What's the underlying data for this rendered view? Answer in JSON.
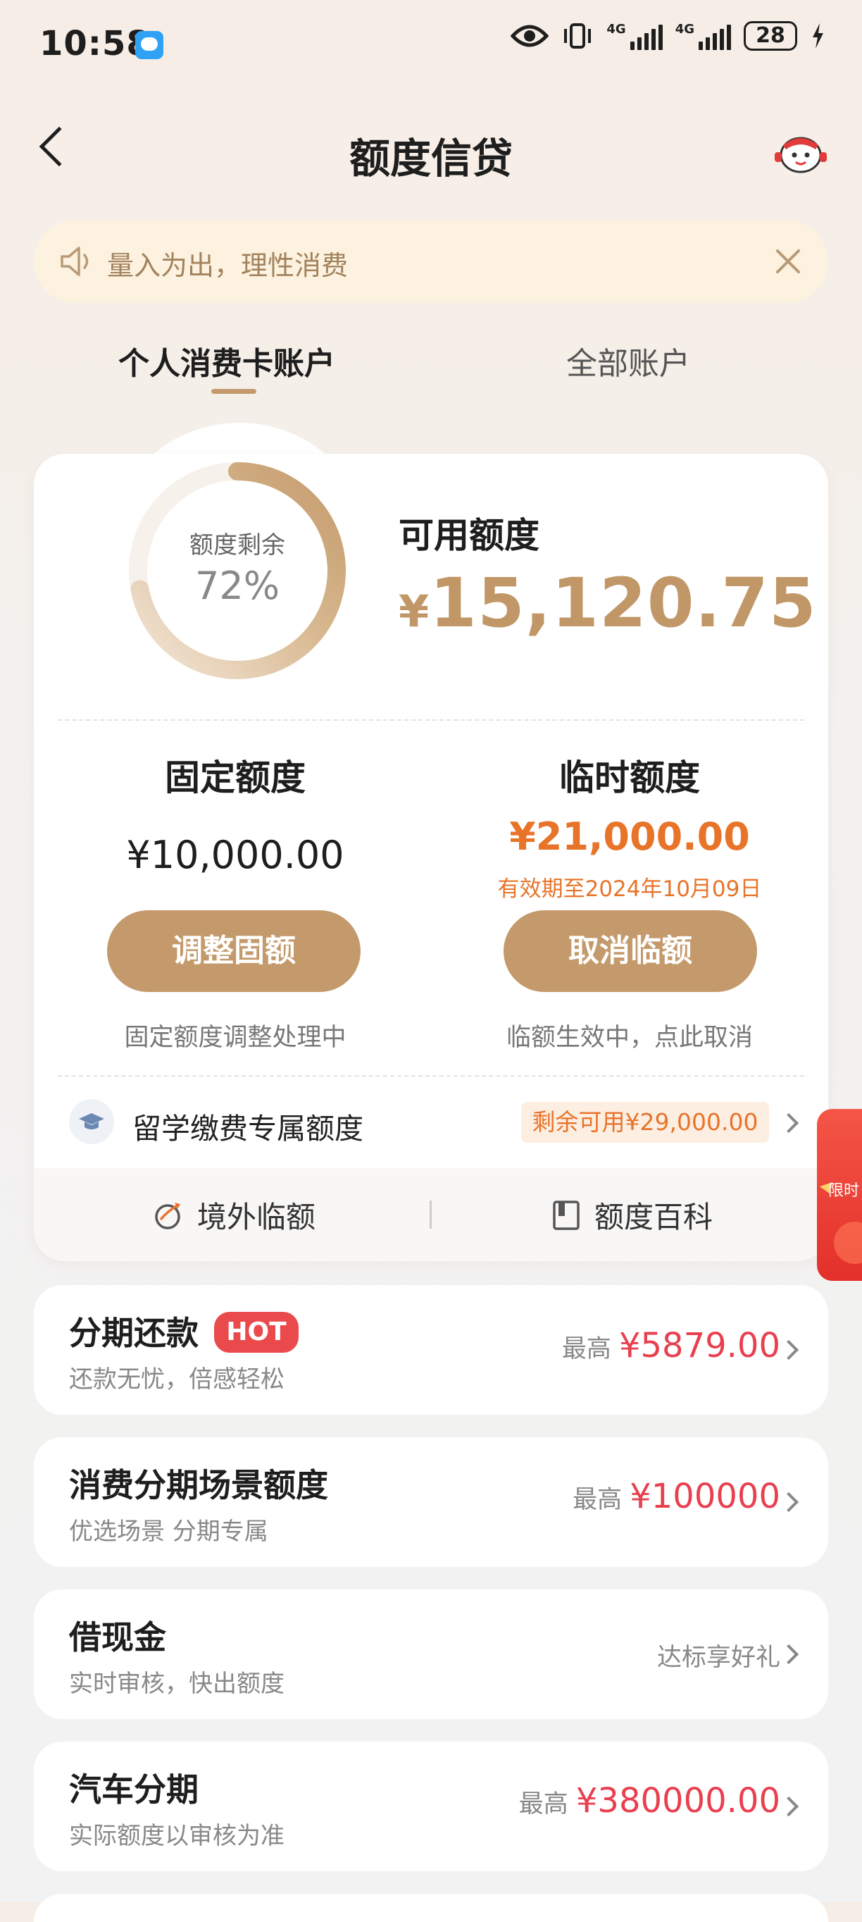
{
  "status_bar": {
    "time": "10:58",
    "net1": "4G",
    "net2": "4G",
    "battery": "28"
  },
  "header": {
    "title": "额度信贷",
    "back_icon": "back-arrow-icon",
    "mascot_icon": "mascot-icon"
  },
  "notice": {
    "text": "量入为出，理性消费",
    "speaker_icon": "speaker-icon",
    "close_icon": "close-icon"
  },
  "tabs": [
    {
      "label": "个人消费卡账户",
      "active": true
    },
    {
      "label": "全部账户",
      "active": false
    }
  ],
  "credit": {
    "ring_label": "额度剩余",
    "ring_value": "72%",
    "ring_fraction": 0.72,
    "available_label": "可用额度",
    "available_currency": "¥",
    "available_amount": "15,120.75"
  },
  "fixed": {
    "title": "固定额度",
    "amount": "¥10,000.00",
    "button": "调整固额",
    "note": "固定额度调整处理中"
  },
  "temporary": {
    "title": "临时额度",
    "amount": "¥21,000.00",
    "expiry": "有效期至2024年10月09日",
    "button": "取消临额",
    "note": "临额生效中，点此取消"
  },
  "study_abroad": {
    "label": "留学缴费专属额度",
    "badge": "剩余可用¥29,000.00"
  },
  "footer_links": [
    {
      "label": "境外临额",
      "icon": "globe-plane-icon"
    },
    {
      "label": "额度百科",
      "icon": "book-icon"
    }
  ],
  "promo": {
    "text": "限时"
  },
  "services": [
    {
      "title": "分期还款",
      "badge": "HOT",
      "subtitle": "还款无忧，倍感轻松",
      "prefix": "最高",
      "amount": "¥5879.00"
    },
    {
      "title": "消费分期场景额度",
      "subtitle": "优选场景 分期专属",
      "prefix": "最高",
      "amount": "¥100000"
    },
    {
      "title": "借现金",
      "subtitle": "实时审核，快出额度",
      "right_text": "达标享好礼"
    },
    {
      "title": "汽车分期",
      "subtitle": "实际额度以审核为准",
      "prefix": "最高",
      "amount": "¥380000.00"
    }
  ],
  "colors": {
    "gold": "#c49a6c",
    "orange": "#e8742a",
    "red": "#e94050",
    "notice_bg": "#fcf2df"
  }
}
